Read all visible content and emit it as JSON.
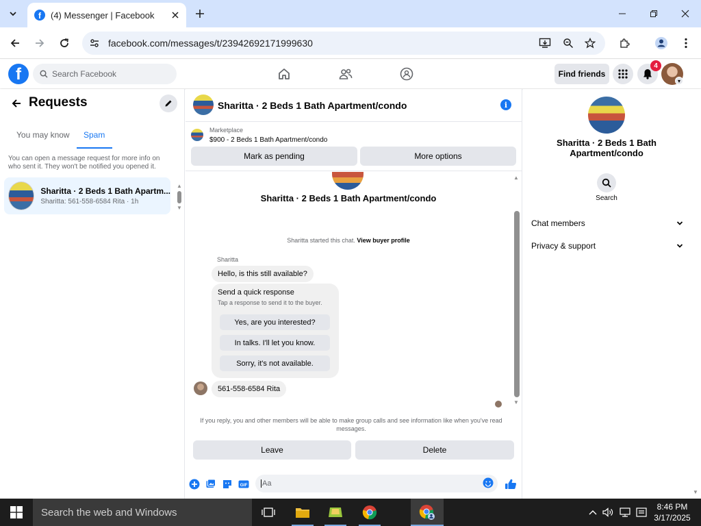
{
  "browser": {
    "tab_title": "(4) Messenger | Facebook",
    "url": "facebook.com/messages/t/23942692171999630"
  },
  "fb": {
    "search_placeholder": "Search Facebook",
    "find_friends": "Find friends",
    "notification_count": "4"
  },
  "requests": {
    "title": "Requests",
    "tabs": [
      "You may know",
      "Spam"
    ],
    "active_tab": "Spam",
    "info": "You can open a message request for more info on who sent it. They won't be notified you opened it.",
    "items": [
      {
        "name": "Sharitta · 2 Beds 1 Bath Apartm...",
        "preview": "Sharitta: 561-558-6584 Rita · 1h"
      }
    ]
  },
  "chat": {
    "title": "Sharitta · 2 Beds 1 Bath Apartment/condo",
    "marketplace_label": "Marketplace",
    "listing": "$900 - 2 Beds 1 Bath Apartment/condo",
    "mark_pending": "Mark as pending",
    "more_options": "More options",
    "thread_name": "Sharitta · 2 Beds 1 Bath Apartment/condo",
    "started_text": "Sharitta started this chat.",
    "view_profile": "View buyer profile",
    "sender": "Sharitta",
    "message1": "Hello, is this still available?",
    "quick_title": "Send a quick response",
    "quick_sub": "Tap a response to send it to the buyer.",
    "quick_replies": [
      "Yes, are you interested?",
      "In talks. I'll let you know.",
      "Sorry, it's not available."
    ],
    "message2": "561-558-6584 Rita",
    "reply_info": "If you reply, you and other members will be able to make group calls and see information like when you've read messages.",
    "leave": "Leave",
    "delete": "Delete",
    "composer_placeholder": "Aa"
  },
  "details": {
    "name": "Sharitta · 2 Beds 1 Bath Apartment/condo",
    "search": "Search",
    "sections": [
      "Chat members",
      "Privacy & support"
    ]
  },
  "taskbar": {
    "search_placeholder": "Search the web and Windows",
    "time": "8:46 PM",
    "date": "3/17/2025"
  }
}
